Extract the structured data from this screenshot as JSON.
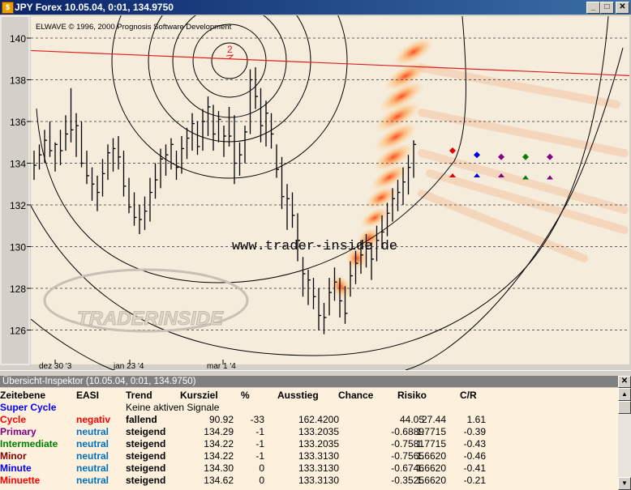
{
  "window": {
    "title": "JPY Forex  10.05.04, 0:01, 134.9750",
    "app_icon": "chart-app-icon",
    "minimize": "_",
    "maximize": "□",
    "close": "✕"
  },
  "chart": {
    "copyright": "ELWAVE © 1996, 2000 Prognosis Software Development",
    "watermark_url": "www.trader-inside.de",
    "watermark_logo": "TRADERINSIDE",
    "wave_label": "2",
    "x_labels": [
      "dez 30 '3",
      "jan 23 '4",
      "mar 1 '4"
    ],
    "colors": {
      "background": "#f6ecdc",
      "bars": "#000000",
      "trendline": "#e02020",
      "target_zone": "#ff4000",
      "circles": "#000000"
    }
  },
  "chart_data": {
    "type": "bar",
    "title": "",
    "ylim": [
      125,
      141
    ],
    "y_ticks": [
      126,
      128,
      130,
      132,
      134,
      136,
      138,
      140
    ],
    "grid": "horizontal dashed",
    "ohlc": [
      {
        "h": 134.6,
        "l": 133.2,
        "c": 133.9
      },
      {
        "h": 134.9,
        "l": 133.7,
        "c": 134.4
      },
      {
        "h": 135.6,
        "l": 134.0,
        "c": 135.1
      },
      {
        "h": 136.0,
        "l": 134.3,
        "c": 134.6
      },
      {
        "h": 135.0,
        "l": 133.6,
        "c": 134.9
      },
      {
        "h": 135.6,
        "l": 133.9,
        "c": 134.6
      },
      {
        "h": 136.3,
        "l": 134.6,
        "c": 135.4
      },
      {
        "h": 137.6,
        "l": 135.0,
        "c": 135.6
      },
      {
        "h": 136.4,
        "l": 134.3,
        "c": 135.8
      },
      {
        "h": 136.0,
        "l": 133.8,
        "c": 134.0
      },
      {
        "h": 134.6,
        "l": 133.0,
        "c": 133.4
      },
      {
        "h": 133.8,
        "l": 132.2,
        "c": 133.0
      },
      {
        "h": 133.4,
        "l": 131.7,
        "c": 132.6
      },
      {
        "h": 134.2,
        "l": 132.4,
        "c": 133.5
      },
      {
        "h": 134.9,
        "l": 133.2,
        "c": 134.5
      },
      {
        "h": 135.2,
        "l": 133.6,
        "c": 134.7
      },
      {
        "h": 135.3,
        "l": 133.7,
        "c": 134.3
      },
      {
        "h": 134.6,
        "l": 132.4,
        "c": 132.9
      },
      {
        "h": 133.3,
        "l": 131.6,
        "c": 131.9
      },
      {
        "h": 132.6,
        "l": 131.0,
        "c": 131.4
      },
      {
        "h": 132.0,
        "l": 130.6,
        "c": 131.3
      },
      {
        "h": 132.4,
        "l": 130.8,
        "c": 131.7
      },
      {
        "h": 133.3,
        "l": 131.2,
        "c": 132.6
      },
      {
        "h": 134.0,
        "l": 132.3,
        "c": 133.2
      },
      {
        "h": 134.7,
        "l": 132.8,
        "c": 134.2
      },
      {
        "h": 134.9,
        "l": 133.4,
        "c": 134.4
      },
      {
        "h": 135.2,
        "l": 133.7,
        "c": 134.9
      },
      {
        "h": 134.6,
        "l": 133.2,
        "c": 133.8
      },
      {
        "h": 135.3,
        "l": 133.5,
        "c": 134.7
      },
      {
        "h": 135.7,
        "l": 134.2,
        "c": 135.2
      },
      {
        "h": 136.4,
        "l": 134.6,
        "c": 135.9
      },
      {
        "h": 136.0,
        "l": 134.4,
        "c": 134.8
      },
      {
        "h": 136.6,
        "l": 134.6,
        "c": 136.0
      },
      {
        "h": 137.2,
        "l": 135.3,
        "c": 136.7
      },
      {
        "h": 136.8,
        "l": 134.6,
        "c": 135.4
      },
      {
        "h": 136.5,
        "l": 135.0,
        "c": 136.1
      },
      {
        "h": 135.8,
        "l": 134.3,
        "c": 135.3
      },
      {
        "h": 136.7,
        "l": 134.8,
        "c": 135.3
      },
      {
        "h": 136.3,
        "l": 133.0,
        "c": 134.0
      },
      {
        "h": 135.0,
        "l": 133.4,
        "c": 134.4
      },
      {
        "h": 135.8,
        "l": 134.0,
        "c": 135.5
      },
      {
        "h": 138.5,
        "l": 135.4,
        "c": 138.0
      },
      {
        "h": 138.6,
        "l": 136.6,
        "c": 137.2
      },
      {
        "h": 137.6,
        "l": 135.0,
        "c": 135.8
      },
      {
        "h": 137.0,
        "l": 134.8,
        "c": 136.4
      },
      {
        "h": 136.4,
        "l": 134.7,
        "c": 135.4
      },
      {
        "h": 134.9,
        "l": 133.3,
        "c": 133.7
      },
      {
        "h": 134.3,
        "l": 131.8,
        "c": 132.4
      },
      {
        "h": 133.0,
        "l": 130.8,
        "c": 132.3
      },
      {
        "h": 132.6,
        "l": 130.9,
        "c": 131.5
      },
      {
        "h": 131.6,
        "l": 129.3,
        "c": 130.3
      },
      {
        "h": 129.5,
        "l": 127.6,
        "c": 128.7
      },
      {
        "h": 128.9,
        "l": 127.2,
        "c": 128.4
      },
      {
        "h": 128.5,
        "l": 127.0,
        "c": 127.6
      },
      {
        "h": 128.0,
        "l": 126.0,
        "c": 126.7
      },
      {
        "h": 127.3,
        "l": 125.8,
        "c": 126.6
      },
      {
        "h": 128.5,
        "l": 126.7,
        "c": 127.8
      },
      {
        "h": 129.0,
        "l": 127.4,
        "c": 128.3
      },
      {
        "h": 128.5,
        "l": 126.6,
        "c": 127.4
      },
      {
        "h": 128.1,
        "l": 126.3,
        "c": 126.8
      },
      {
        "h": 129.3,
        "l": 127.6,
        "c": 128.6
      },
      {
        "h": 129.8,
        "l": 128.2,
        "c": 129.2
      },
      {
        "h": 130.3,
        "l": 128.7,
        "c": 129.6
      },
      {
        "h": 130.6,
        "l": 129.0,
        "c": 129.9
      },
      {
        "h": 130.2,
        "l": 128.4,
        "c": 129.4
      },
      {
        "h": 131.0,
        "l": 129.3,
        "c": 130.3
      },
      {
        "h": 131.5,
        "l": 129.9,
        "c": 130.7
      },
      {
        "h": 132.1,
        "l": 130.5,
        "c": 131.6
      },
      {
        "h": 132.8,
        "l": 131.2,
        "c": 132.3
      },
      {
        "h": 133.2,
        "l": 131.7,
        "c": 132.6
      },
      {
        "h": 133.8,
        "l": 132.0,
        "c": 133.1
      },
      {
        "h": 134.4,
        "l": 132.5,
        "c": 133.8
      },
      {
        "h": 135.1,
        "l": 133.3,
        "c": 134.9
      }
    ],
    "trendline": [
      [
        0,
        139.4
      ],
      [
        1,
        138.2
      ]
    ],
    "target_markers": [
      {
        "y": 134.6,
        "color": "#e00000"
      },
      {
        "y": 134.4,
        "color": "#0000e0"
      },
      {
        "y": 134.3,
        "color": "#800080"
      },
      {
        "y": 134.3,
        "color": "#008000"
      },
      {
        "y": 134.3,
        "color": "#800080"
      }
    ],
    "stop_markers": [
      {
        "y": 133.4,
        "color": "#e00000"
      },
      {
        "y": 133.4,
        "color": "#0000e0"
      },
      {
        "y": 133.4,
        "color": "#800080"
      },
      {
        "y": 133.3,
        "color": "#008000"
      },
      {
        "y": 133.3,
        "color": "#800080"
      }
    ]
  },
  "inspector": {
    "title": "Übersicht-Inspektor (10.05.04, 0:01, 134.9750)",
    "close": "✕",
    "headers": [
      "Zeitebene",
      "EASI",
      "Trend",
      "Kursziel",
      "%",
      "Ausstieg",
      "Chance",
      "Risiko",
      "C/R"
    ],
    "rows": [
      {
        "level": "Super Cycle",
        "level_color": "#0000ff",
        "easi": "",
        "easi_color": "#000000",
        "trend": "Keine aktiven Signale",
        "kursziel": "",
        "pct": "",
        "ausstieg": "",
        "chance": "",
        "risiko": "",
        "cr": ""
      },
      {
        "level": "Cycle",
        "level_color": "#ff0000",
        "easi": "negativ",
        "easi_color": "#ff0000",
        "trend": "fallend",
        "kursziel": "90.92",
        "pct": "-33",
        "ausstieg": "162.4200",
        "chance": "44.05",
        "risiko": "27.44",
        "cr": "1.61"
      },
      {
        "level": "Primary",
        "level_color": "#800080",
        "easi": "neutral",
        "easi_color": "#0070c0",
        "trend": "steigend",
        "kursziel": "134.29",
        "pct": "-1",
        "ausstieg": "133.2035",
        "chance": "-0.6889",
        "risiko": "1.7715",
        "cr": "-0.39"
      },
      {
        "level": "Intermediate",
        "level_color": "#008000",
        "easi": "neutral",
        "easi_color": "#0070c0",
        "trend": "steigend",
        "kursziel": "134.22",
        "pct": "-1",
        "ausstieg": "133.2035",
        "chance": "-0.7581",
        "risiko": "1.7715",
        "cr": "-0.43"
      },
      {
        "level": "Minor",
        "level_color": "#800000",
        "easi": "neutral",
        "easi_color": "#0070c0",
        "trend": "steigend",
        "kursziel": "134.22",
        "pct": "-1",
        "ausstieg": "133.3130",
        "chance": "-0.7565",
        "risiko": "1.6620",
        "cr": "-0.46"
      },
      {
        "level": "Minute",
        "level_color": "#0000ff",
        "easi": "neutral",
        "easi_color": "#0070c0",
        "trend": "steigend",
        "kursziel": "134.30",
        "pct": "0",
        "ausstieg": "133.3130",
        "chance": "-0.6746",
        "risiko": "1.6620",
        "cr": "-0.41"
      },
      {
        "level": "Minuette",
        "level_color": "#ff0000",
        "easi": "neutral",
        "easi_color": "#0070c0",
        "trend": "steigend",
        "kursziel": "134.62",
        "pct": "0",
        "ausstieg": "133.3130",
        "chance": "-0.3525",
        "risiko": "1.6620",
        "cr": "-0.21"
      }
    ]
  }
}
